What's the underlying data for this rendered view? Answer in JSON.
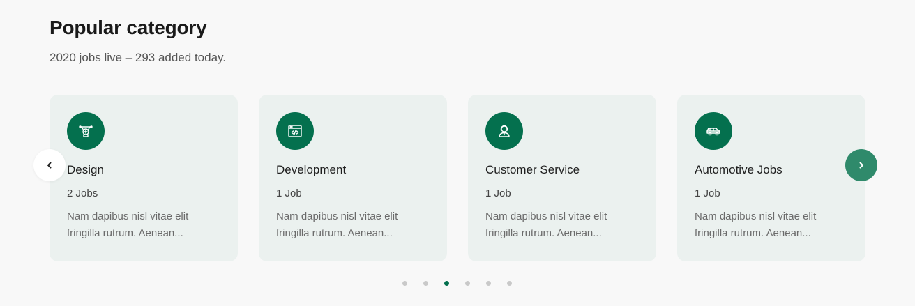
{
  "header": {
    "title": "Popular category",
    "subtitle": "2020 jobs live – 293 added today."
  },
  "colors": {
    "accent": "#04704e",
    "card_bg": "#ebf1ef",
    "next_button": "#2f8a6b"
  },
  "cards": [
    {
      "name": "Design",
      "count": "2 Jobs",
      "description": "Nam dapibus nisl vitae elit fringilla rutrum. Aenean...",
      "icon": "design-icon"
    },
    {
      "name": "Development",
      "count": "1 Job",
      "description": "Nam dapibus nisl vitae elit fringilla rutrum. Aenean...",
      "icon": "code-window-icon"
    },
    {
      "name": "Customer Service",
      "count": "1 Job",
      "description": "Nam dapibus nisl vitae elit fringilla rutrum. Aenean...",
      "icon": "support-agent-icon"
    },
    {
      "name": "Automotive Jobs",
      "count": "1 Job",
      "description": "Nam dapibus nisl vitae elit fringilla rutrum. Aenean...",
      "icon": "car-icon"
    }
  ],
  "carousel": {
    "prev_icon": "chevron-left-icon",
    "next_icon": "chevron-right-icon",
    "page_count": 6,
    "active_page": 3
  }
}
